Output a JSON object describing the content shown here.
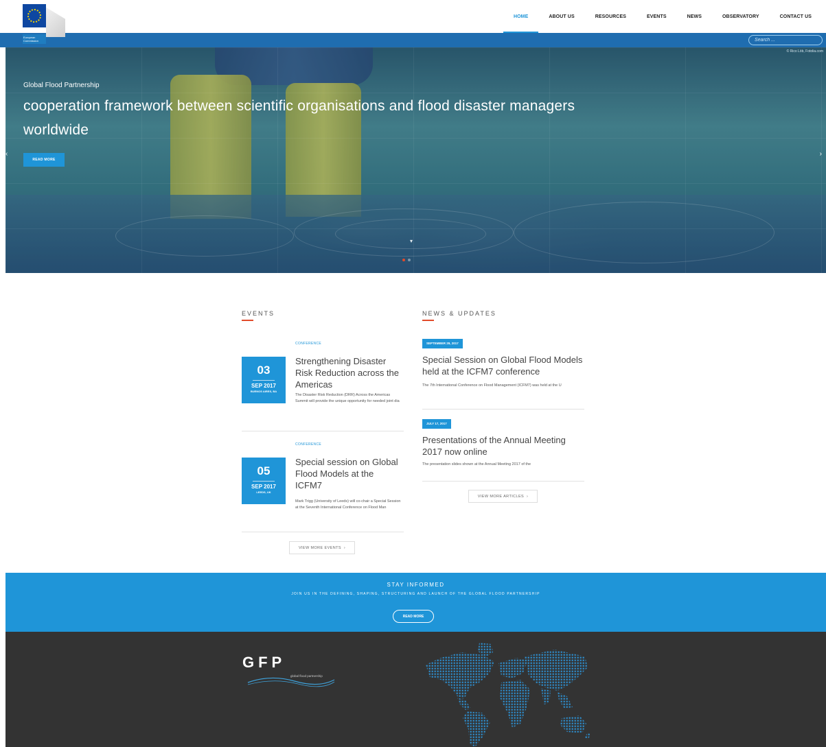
{
  "header": {
    "logo_text": "European Commission",
    "nav": [
      {
        "label": "HOME",
        "active": true
      },
      {
        "label": "ABOUT US",
        "active": false
      },
      {
        "label": "RESOURCES",
        "active": false
      },
      {
        "label": "EVENTS",
        "active": false
      },
      {
        "label": "NEWS",
        "active": false
      },
      {
        "label": "OBSERVATORY",
        "active": false
      },
      {
        "label": "CONTACT US",
        "active": false
      }
    ],
    "search_placeholder": "Search ..."
  },
  "hero": {
    "credit": "© Rico Löb, Fotolia.com",
    "kicker": "Global Flood Partnership",
    "title": "cooperation framework between scientific organisations and flood disaster managers worldwide",
    "button": "READ MORE",
    "prev": "‹",
    "next": "›",
    "scroll": "▾"
  },
  "events": {
    "title": "EVENTS",
    "items": [
      {
        "category": "CONFERENCE",
        "day": "03",
        "month": "SEP 2017",
        "place": "BUENOS AIRES, BA",
        "title": "Strengthening Disaster Risk Reduction across the Americas",
        "desc": "The Disaster Risk Reduction (DRR) Across the Americas Summit will provide the unique opportunity for needed joint dia"
      },
      {
        "category": "CONFERENCE",
        "day": "05",
        "month": "SEP 2017",
        "place": "LEEDS, UK",
        "title": "Special session on Global Flood Models at the ICFM7",
        "desc": "Mark Trigg (University of Leeds) will co-chair a Special Session at the Seventh International Conference on Flood Man"
      }
    ],
    "more": "VIEW MORE EVENTS"
  },
  "news": {
    "title": "NEWS & UPDATES",
    "items": [
      {
        "date": "SEPTEMBER 29, 2017",
        "title": "Special Session on Global Flood Models held at the ICFM7 conference",
        "desc": "The 7th International Conference on Flood Management (ICFM7) was held at the U"
      },
      {
        "date": "JULY 17, 2017",
        "title": "Presentations of the Annual Meeting 2017 now online",
        "desc": "The presentation slides shown at the Annual Meeting 2017 of the"
      }
    ],
    "more": "VIEW MORE ARTICLES"
  },
  "stay": {
    "title": "STAY INFORMED",
    "subtitle": "JOIN US IN THE DEFINING, SHAPING, STRUCTURING AND LAUNCH OF THE GLOBAL FLOOD PARTNERSHIP",
    "button": "READ MORE"
  },
  "footer": {
    "logo_letters": "GFP",
    "logo_tagline": "global flood partnership"
  },
  "colors": {
    "accent": "#1f95d8",
    "strip": "#1f6db0",
    "underline": "#e24a2a",
    "footer": "#333333"
  }
}
